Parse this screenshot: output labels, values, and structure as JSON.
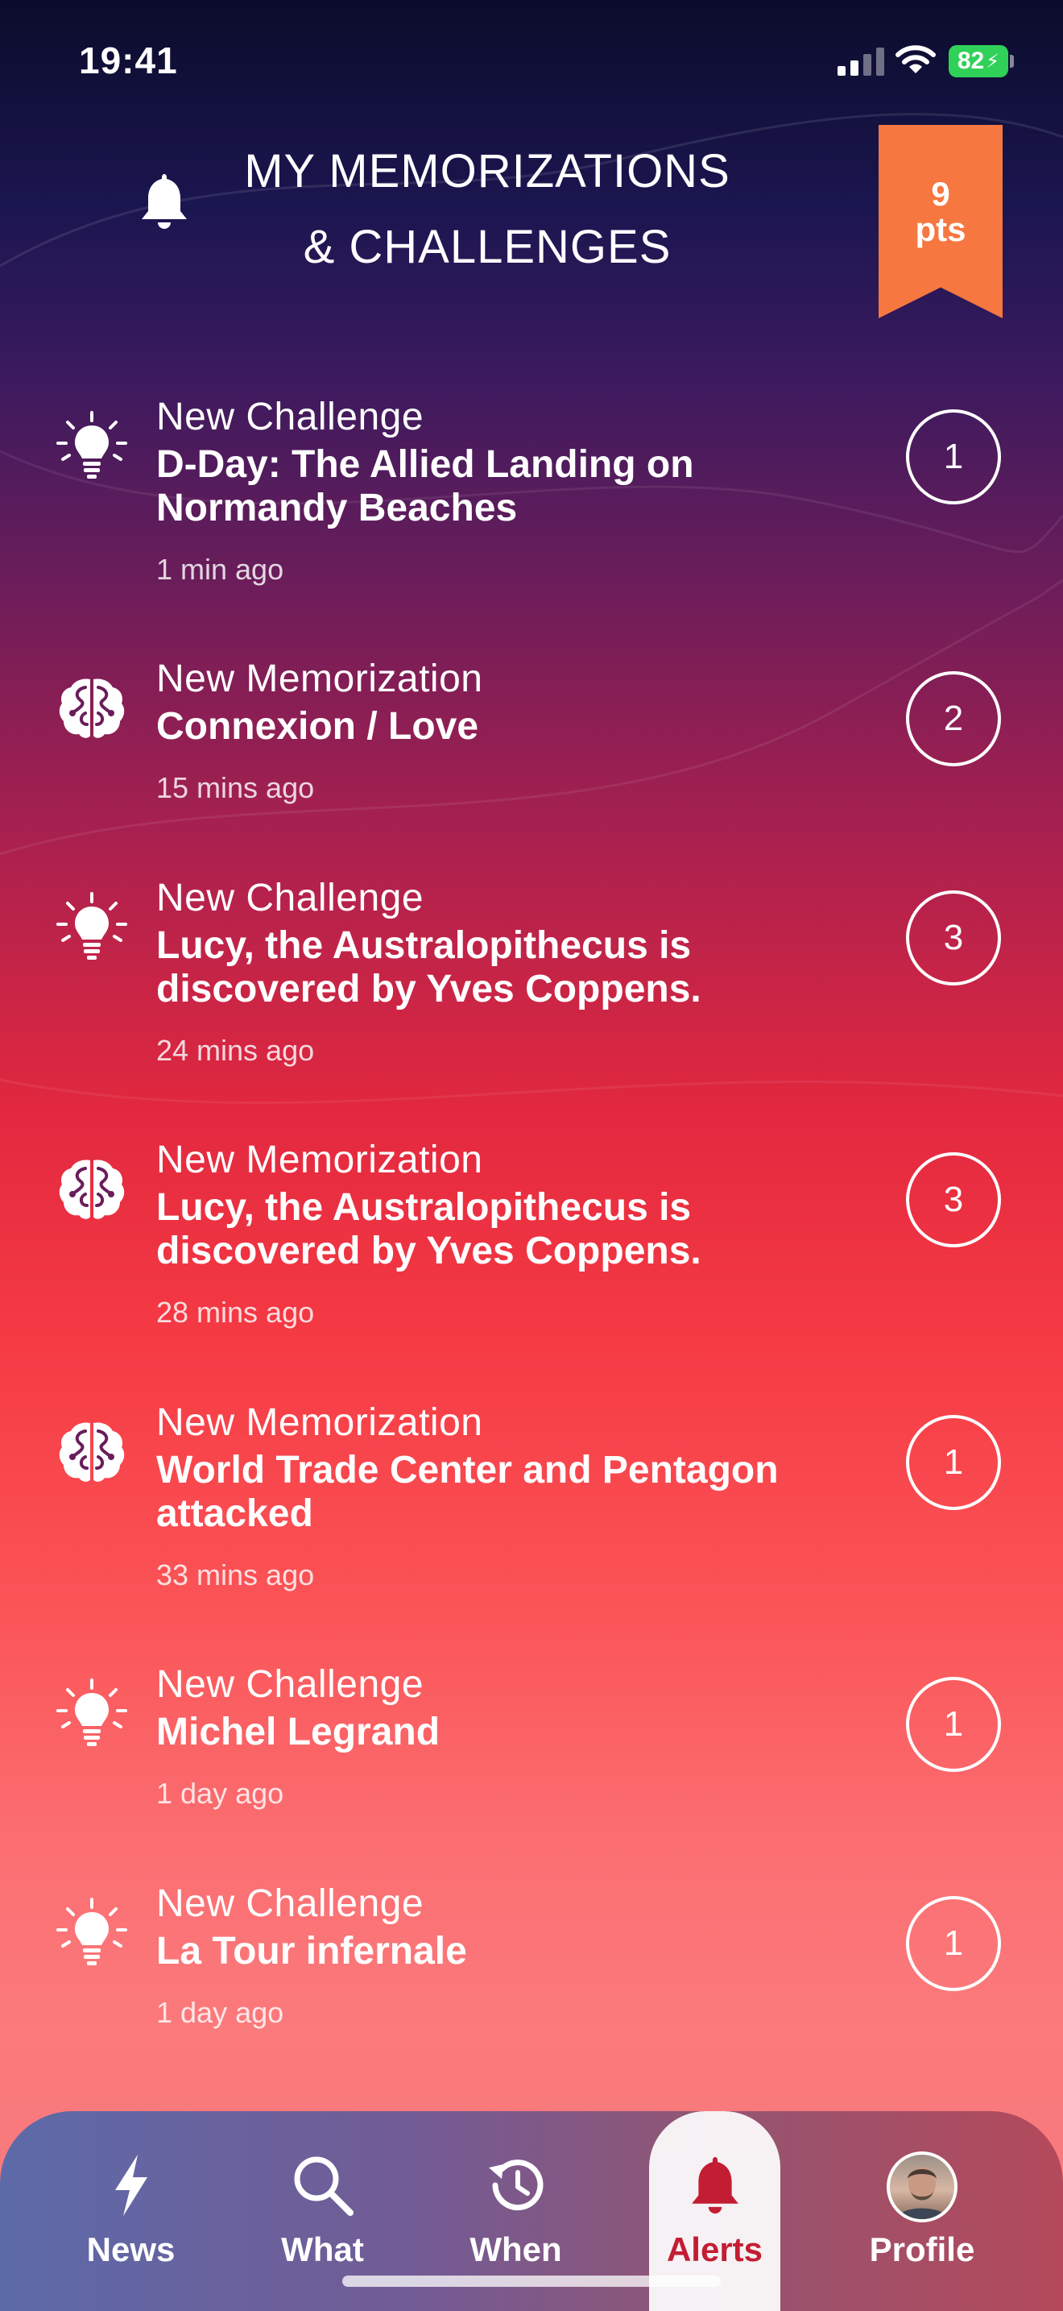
{
  "status_bar": {
    "time": "19:41",
    "battery": "82"
  },
  "header": {
    "title_line1": "MY MEMORIZATIONS",
    "title_line2": "& CHALLENGES",
    "points_value": "9",
    "points_unit": "pts",
    "icon": "bell-icon"
  },
  "alerts": [
    {
      "kind": "New Challenge",
      "icon": "lightbulb-icon",
      "title": "D-Day: The Allied Landing on Normandy Beaches",
      "ago": "1 min ago",
      "count": "1"
    },
    {
      "kind": "New Memorization",
      "icon": "brain-icon",
      "title": "Connexion / Love",
      "ago": "15 mins ago",
      "count": "2"
    },
    {
      "kind": "New Challenge",
      "icon": "lightbulb-icon",
      "title": "Lucy, the Australopithecus is discovered by Yves Coppens.",
      "ago": "24 mins ago",
      "count": "3"
    },
    {
      "kind": "New Memorization",
      "icon": "brain-icon",
      "title": "Lucy, the Australopithecus is discovered by Yves Coppens.",
      "ago": "28 mins ago",
      "count": "3"
    },
    {
      "kind": "New Memorization",
      "icon": "brain-icon",
      "title": "World Trade Center and Pentagon attacked",
      "ago": "33 mins ago",
      "count": "1"
    },
    {
      "kind": "New Challenge",
      "icon": "lightbulb-icon",
      "title": "Michel Legrand",
      "ago": "1 day ago",
      "count": "1"
    },
    {
      "kind": "New Challenge",
      "icon": "lightbulb-icon",
      "title": "La Tour infernale",
      "ago": "1 day ago",
      "count": "1"
    }
  ],
  "tabs": [
    {
      "label": "News",
      "icon": "lightning-icon"
    },
    {
      "label": "What",
      "icon": "search-icon"
    },
    {
      "label": "When",
      "icon": "history-icon"
    },
    {
      "label": "Alerts",
      "icon": "bell-icon",
      "active": true
    },
    {
      "label": "Profile",
      "icon": "avatar"
    }
  ],
  "colors": {
    "points_ribbon": "#f6773f",
    "active_tab_text": "#c8192e",
    "battery": "#2fd158"
  }
}
